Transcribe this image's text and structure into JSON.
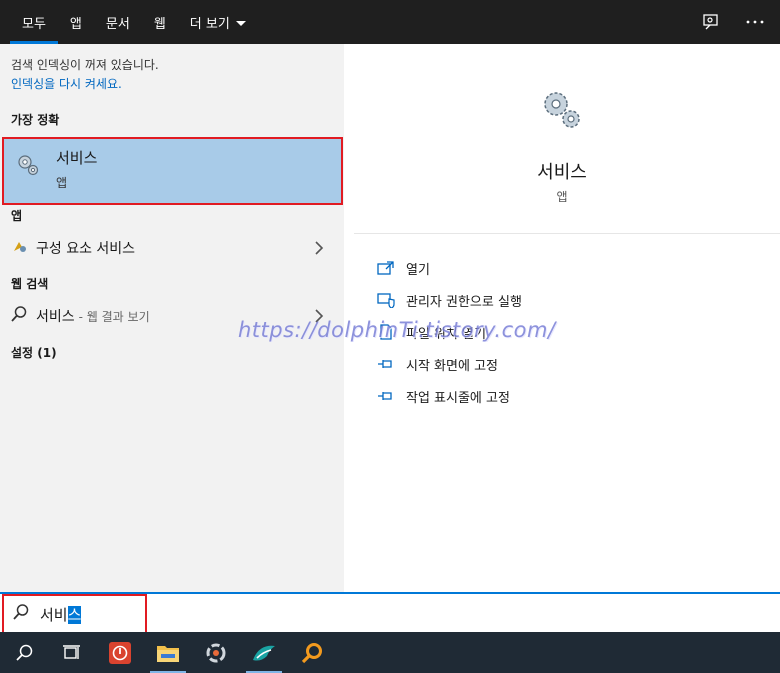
{
  "tabs": [
    {
      "label": "모두",
      "active": true
    },
    {
      "label": "앱"
    },
    {
      "label": "문서"
    },
    {
      "label": "웹"
    },
    {
      "label": "더 보기"
    }
  ],
  "top_icons": [
    "feedback-icon",
    "more-icon"
  ],
  "left": {
    "notice_line1": "검색 인덱싱이 꺼져 있습니다.",
    "notice_link": "인덱싱을 다시 켜세요.",
    "best_match_header": "가장 정확",
    "best_match": {
      "title": "서비스",
      "sub": "앱"
    },
    "apps_header": "앱",
    "apps_item": "구성 요소 서비스",
    "web_header": "웹 검색",
    "web_item": "서비스",
    "web_hint": "- 웹 결과 보기",
    "settings_header": "설정 (1)"
  },
  "right": {
    "title": "서비스",
    "sub": "앱",
    "actions": [
      {
        "label": "열기",
        "icon": "open-icon"
      },
      {
        "label": "관리자 권한으로 실행",
        "icon": "shield-icon"
      },
      {
        "label": "파일 위치 열기",
        "icon": "file-icon"
      },
      {
        "label": "시작 화면에 고정",
        "icon": "pin-icon"
      },
      {
        "label": "작업 표시줄에 고정",
        "icon": "pin-icon"
      }
    ]
  },
  "search": {
    "typed": "서비",
    "selected": "스"
  },
  "watermark": "https://dolphinTi.tistory.com/",
  "taskbar": [
    "search-icon",
    "task-view-icon",
    "app-red-icon",
    "file-explorer-icon",
    "app-circle-icon",
    "app-bird-icon",
    "app-search-orange-icon"
  ],
  "colors": {
    "accent": "#0078d7",
    "highlight": "#a8cbe8",
    "annotation": "#e11b22"
  }
}
